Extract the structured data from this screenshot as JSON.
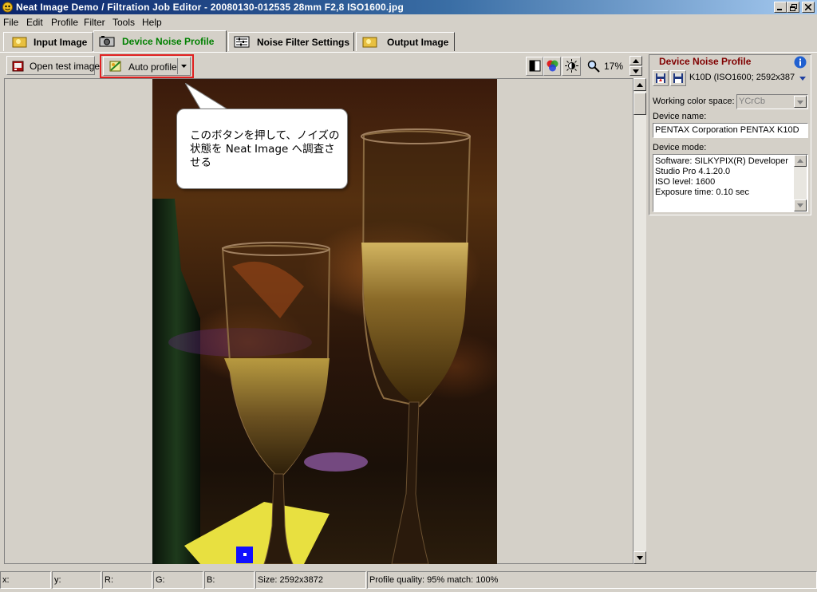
{
  "window": {
    "title": "Neat Image Demo / Filtration Job Editor - 20080130-012535 28mm F2,8 ISO1600.jpg",
    "app_icon": "neat-image-icon",
    "controls": [
      "minimize",
      "maximize",
      "close"
    ]
  },
  "menu": [
    {
      "label": "File"
    },
    {
      "label": "Edit"
    },
    {
      "label": "Profile"
    },
    {
      "label": "Filter"
    },
    {
      "label": "Tools"
    },
    {
      "label": "Help"
    }
  ],
  "tabs": [
    {
      "label": "Input Image",
      "active": false,
      "icon": "image-icon"
    },
    {
      "label": "Device Noise Profile",
      "active": true,
      "icon": "camera-icon",
      "color": "#008000"
    },
    {
      "label": "Noise Filter Settings",
      "active": false,
      "icon": "sliders-icon"
    },
    {
      "label": "Output Image",
      "active": false,
      "icon": "image-icon"
    }
  ],
  "toolbar": {
    "open_test_image": "Open test image",
    "auto_profile": "Auto profile",
    "zoom_level": "17%",
    "highlight_color": "#e02020"
  },
  "callout": {
    "text": "このボタンを押して、ノイズの状態を Neat Image へ調査させる"
  },
  "device_profile_panel": {
    "header": "Device Noise Profile",
    "header_color": "#800000",
    "profile_select": "K10D (ISO1600; 2592x387",
    "working_color_space_label": "Working color space:",
    "working_color_space_value": "YCrCb",
    "device_name_label": "Device name:",
    "device_name_value": "PENTAX Corporation PENTAX K10D",
    "device_mode_label": "Device mode:",
    "device_mode_lines": [
      "Software: SILKYPIX(R) Developer",
      "Studio Pro 4.1.20.0",
      "ISO level: 1600",
      "Exposure time: 0.10 sec"
    ]
  },
  "status": {
    "x": "x:",
    "y": "y:",
    "r": "R:",
    "g": "G:",
    "b": "B:",
    "size": "Size: 2592x3872",
    "quality": "Profile quality: 95%  match: 100%"
  }
}
